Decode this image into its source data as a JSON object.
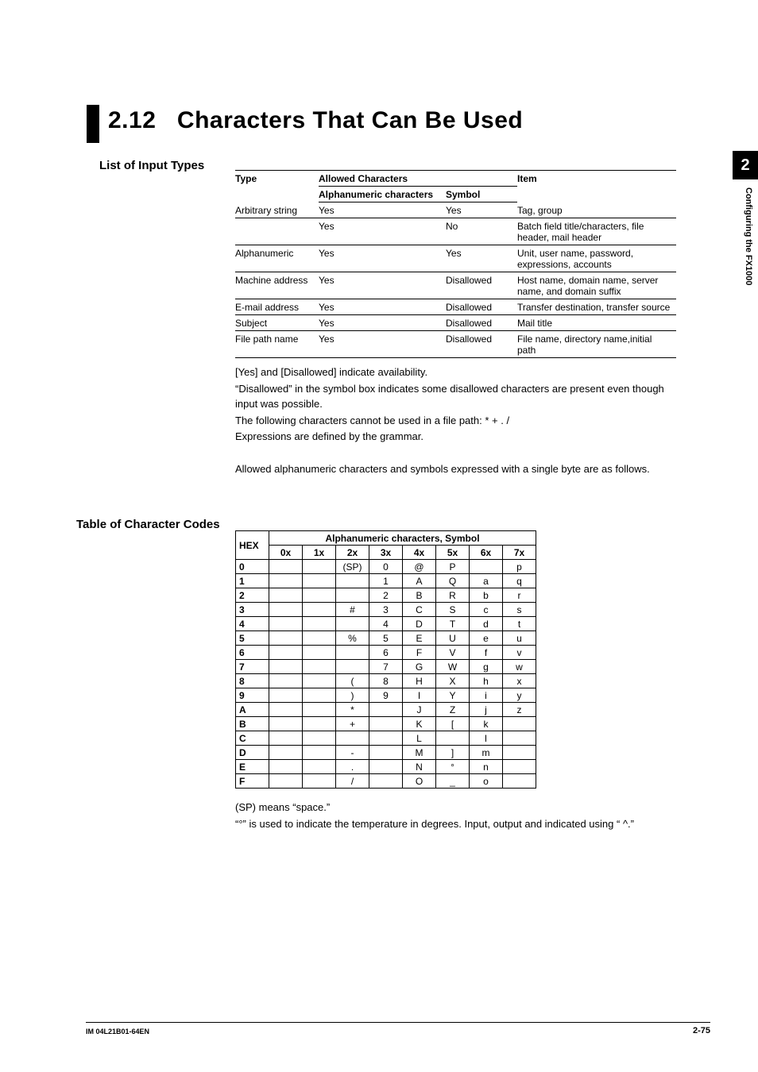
{
  "page": {
    "section_number": "2.12",
    "section_title": "Characters That Can Be Used",
    "chapter_tab": "2",
    "chapter_side": "Configuring the FX1000",
    "footer_left": "IM 04L21B01-64EN",
    "footer_right": "2-75"
  },
  "input_types": {
    "heading": "List of Input Types",
    "header": {
      "type": "Type",
      "allowed": "Allowed Characters",
      "alpha": "Alphanumeric characters",
      "symbol": "Symbol",
      "item": "Item"
    },
    "rows": [
      {
        "type": "Arbitrary string",
        "alpha": "Yes",
        "symbol": "Yes",
        "item": "Tag, group"
      },
      {
        "type": "",
        "alpha": "Yes",
        "symbol": "No",
        "item": "Batch field title/characters, file header, mail header"
      },
      {
        "type": "Alphanumeric",
        "alpha": "Yes",
        "symbol": "Yes",
        "item": "Unit, user name, password, expressions, accounts"
      },
      {
        "type": "Machine address",
        "alpha": "Yes",
        "symbol": "Disallowed",
        "item": "Host name, domain name, server name, and domain suffix"
      },
      {
        "type": "E-mail address",
        "alpha": "Yes",
        "symbol": "Disallowed",
        "item": "Transfer destination, transfer source"
      },
      {
        "type": "Subject",
        "alpha": "Yes",
        "symbol": "Disallowed",
        "item": "Mail title"
      },
      {
        "type": "File path name",
        "alpha": "Yes",
        "symbol": "Disallowed",
        "item": "File name, directory name,initial path"
      }
    ],
    "notes": [
      "[Yes] and [Disallowed] indicate availability.",
      "“Disallowed” in the symbol box indicates some disallowed characters are present even though input was possible.",
      "The following characters cannot be used in a file path: * + . /",
      "Expressions are defined by the grammar."
    ],
    "notes2": [
      "Allowed alphanumeric characters and symbols expressed with a single byte are as follows."
    ]
  },
  "codes": {
    "heading": "Table of Character Codes",
    "header": {
      "hex": "HEX",
      "span": "Alphanumeric characters, Symbol"
    },
    "cols": [
      "0x",
      "1x",
      "2x",
      "3x",
      "4x",
      "5x",
      "6x",
      "7x"
    ],
    "rows": [
      {
        "h": "0",
        "c": [
          "",
          "",
          "(SP)",
          "0",
          "@",
          "P",
          "",
          "p"
        ]
      },
      {
        "h": "1",
        "c": [
          "",
          "",
          "",
          "1",
          "A",
          "Q",
          "a",
          "q"
        ]
      },
      {
        "h": "2",
        "c": [
          "",
          "",
          "",
          "2",
          "B",
          "R",
          "b",
          "r"
        ]
      },
      {
        "h": "3",
        "c": [
          "",
          "",
          "#",
          "3",
          "C",
          "S",
          "c",
          "s"
        ]
      },
      {
        "h": "4",
        "c": [
          "",
          "",
          "",
          "4",
          "D",
          "T",
          "d",
          "t"
        ]
      },
      {
        "h": "5",
        "c": [
          "",
          "",
          "%",
          "5",
          "E",
          "U",
          "e",
          "u"
        ]
      },
      {
        "h": "6",
        "c": [
          "",
          "",
          "",
          "6",
          "F",
          "V",
          "f",
          "v"
        ]
      },
      {
        "h": "7",
        "c": [
          "",
          "",
          "",
          "7",
          "G",
          "W",
          "g",
          "w"
        ]
      },
      {
        "h": "8",
        "c": [
          "",
          "",
          "(",
          "8",
          "H",
          "X",
          "h",
          "x"
        ]
      },
      {
        "h": "9",
        "c": [
          "",
          "",
          ")",
          "9",
          "I",
          "Y",
          "i",
          "y"
        ]
      },
      {
        "h": "A",
        "c": [
          "",
          "",
          "*",
          "",
          "J",
          "Z",
          "j",
          "z"
        ]
      },
      {
        "h": "B",
        "c": [
          "",
          "",
          "+",
          "",
          "K",
          "[",
          "k",
          ""
        ]
      },
      {
        "h": "C",
        "c": [
          "",
          "",
          "",
          "",
          "L",
          "",
          "l",
          ""
        ]
      },
      {
        "h": "D",
        "c": [
          "",
          "",
          "-",
          "",
          "M",
          "]",
          "m",
          ""
        ]
      },
      {
        "h": "E",
        "c": [
          "",
          "",
          ".",
          "",
          "N",
          "°",
          "n",
          ""
        ]
      },
      {
        "h": "F",
        "c": [
          "",
          "",
          "/",
          "",
          "O",
          "_",
          "o",
          ""
        ]
      }
    ],
    "notes": [
      "(SP) means “space.”",
      "“°” is used to indicate the temperature in degrees. Input, output and indicated using “ ^.”"
    ]
  }
}
